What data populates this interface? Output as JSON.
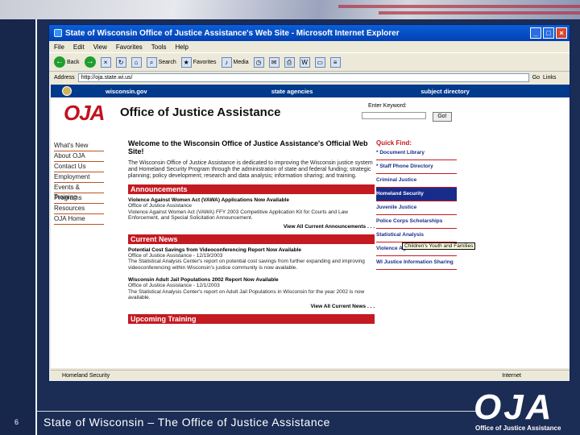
{
  "window": {
    "title": "State of Wisconsin Office of Justice Assistance's Web Site - Microsoft Internet Explorer"
  },
  "menu": [
    "File",
    "Edit",
    "View",
    "Favorites",
    "Tools",
    "Help"
  ],
  "toolbar": {
    "back": "Back",
    "search": "Search",
    "favorites": "Favorites",
    "media": "Media"
  },
  "address": {
    "label": "Address",
    "value": "http://oja.state.wi.us/",
    "go": "Go",
    "links": "Links"
  },
  "site_nav": {
    "home": "wisconsin.gov",
    "agencies": "state agencies",
    "directory": "subject directory"
  },
  "site": {
    "title": "Office of Justice Assistance",
    "logo": "OJA",
    "keyword_label": "Enter Keyword:",
    "go_label": "Go!"
  },
  "left_nav": [
    "What's New",
    "About OJA",
    "Contact Us",
    "Employment",
    "Events & Training",
    "Programs",
    "Resources",
    "OJA Home"
  ],
  "welcome": {
    "heading": "Welcome to the Wisconsin Office of Justice Assistance's Official Web Site!",
    "text": "The Wisconsin Office of Justice Assistance is dedicated to improving the Wisconsin justice system and Homeland Security Program through the administration of state and federal funding; strategic planning; policy development; research and data analysis; information sharing; and training."
  },
  "announcements": {
    "header": "Announcements",
    "item_title": "Violence Against Women Act (VAWA) Applications Now Available",
    "item_sub": "Office of Justice Assistance",
    "item_text": "Violence Against Women Act (VAWA) FFY 2003 Competitive Application Kit for Courts and Law Enforcement, and Special Solicitation Announcement.",
    "view_all": "View All Current Announcements . . ."
  },
  "news": {
    "header": "Current News",
    "item1_title": "Potential Cost Savings from Videoconferencing Report Now Available",
    "item1_sub": "Office of Justice Assistance - 12/19/2003",
    "item1_text": "The Statistical Analysis Center's report on potential cost savings from further expanding and improving videoconferencing within Wisconsin's justice community is now available.",
    "item2_title": "Wisconsin Adult Jail Populations 2002 Report Now Available",
    "item2_sub": "Office of Justice Assistance - 12/1/2003",
    "item2_text": "The Statistical Analysis Center's report on Adult Jail Populations in Wisconsin for the year 2002 is now available.",
    "view_all": "View All Current News . . .",
    "next_header": "Upcoming Training"
  },
  "quick_find": {
    "header": "Quick Find:",
    "items": [
      "* Document Library",
      "* Staff Phone Directory",
      "Criminal Justice",
      "Homeland Security",
      "Juvenile Justice",
      "Police Corps Scholarships",
      "Statistical Analysis",
      "Violence Against Women Act",
      "WI Justice Information Sharing"
    ],
    "tooltip": "Children's Youth and Families"
  },
  "status": {
    "left": "Homeland Security",
    "right": "Internet"
  },
  "slide": {
    "number": "6",
    "footer": "State of Wisconsin – The Office of Justice Assistance",
    "logo": "OJA",
    "logo_sub": "Office of Justice Assistance"
  }
}
